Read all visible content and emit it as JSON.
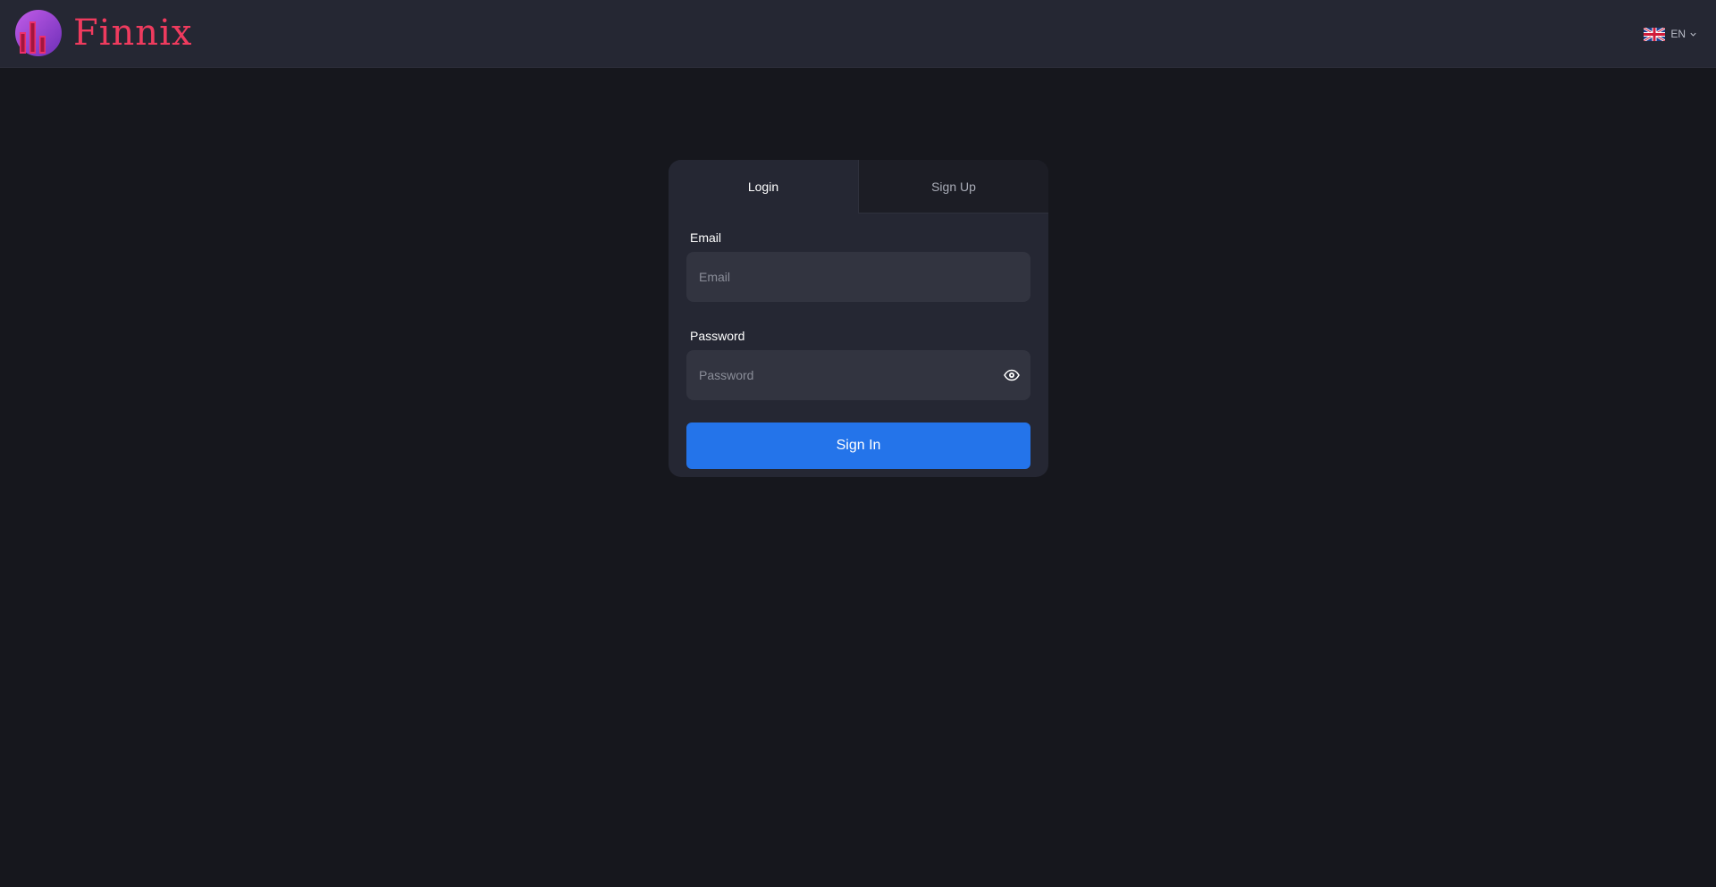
{
  "header": {
    "brand": "Finnix",
    "logo_icon": "bar-chart-globe-icon",
    "language": {
      "code": "EN",
      "flag_icon": "uk-flag-icon",
      "dropdown_icon": "chevron-down-icon"
    }
  },
  "auth": {
    "tabs": [
      {
        "label": "Login",
        "active": true
      },
      {
        "label": "Sign Up",
        "active": false
      }
    ],
    "email": {
      "label": "Email",
      "placeholder": "Email",
      "value": ""
    },
    "password": {
      "label": "Password",
      "placeholder": "Password",
      "value": "",
      "toggle_icon": "eye-icon"
    },
    "submit_label": "Sign In"
  },
  "colors": {
    "background": "#16171d",
    "header": "#252733",
    "card": "#252733",
    "input": "#323440",
    "brand": "#ef3b5e",
    "primary": "#2474ea"
  }
}
